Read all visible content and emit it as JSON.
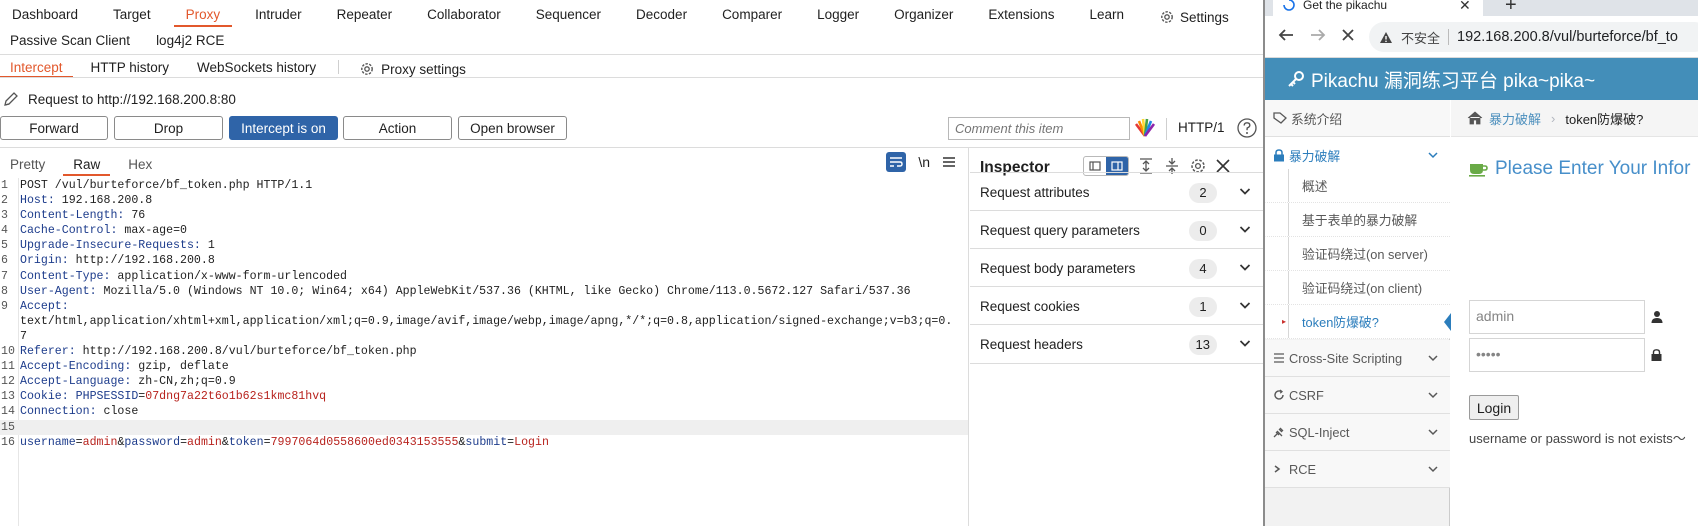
{
  "burp": {
    "main_tabs": [
      "Dashboard",
      "Target",
      "Proxy",
      "Intruder",
      "Repeater",
      "Collaborator",
      "Sequencer",
      "Decoder",
      "Comparer",
      "Logger",
      "Organizer",
      "Extensions",
      "Learn"
    ],
    "settings_label": "Settings",
    "ext_tabs": [
      "Passive Scan Client",
      "log4j2 RCE"
    ],
    "proxy_tabs": [
      "Intercept",
      "HTTP history",
      "WebSockets history"
    ],
    "proxy_settings_label": "Proxy settings",
    "request_to": "Request to http://192.168.200.8:80",
    "buttons": {
      "forward": "Forward",
      "drop": "Drop",
      "intercept": "Intercept is on",
      "action": "Action",
      "open_browser": "Open browser"
    },
    "comment_placeholder": "Comment this item",
    "http_version": "HTTP/1",
    "editor_tabs": [
      "Pretty",
      "Raw",
      "Hex"
    ],
    "newline_toggle": "\\n",
    "request_lines": [
      {
        "n": "1",
        "parts": [
          {
            "t": "POST /vul/burteforce/bf_token.php HTTP/1.1",
            "c": "hv"
          }
        ]
      },
      {
        "n": "2",
        "parts": [
          {
            "t": "Host:",
            "c": "hk"
          },
          {
            "t": " 192.168.200.8",
            "c": "hv"
          }
        ]
      },
      {
        "n": "3",
        "parts": [
          {
            "t": "Content-Length:",
            "c": "hk"
          },
          {
            "t": " 76",
            "c": "hv"
          }
        ]
      },
      {
        "n": "4",
        "parts": [
          {
            "t": "Cache-Control:",
            "c": "hk"
          },
          {
            "t": " max-age=0",
            "c": "hv"
          }
        ]
      },
      {
        "n": "5",
        "parts": [
          {
            "t": "Upgrade-Insecure-Requests:",
            "c": "hk"
          },
          {
            "t": " 1",
            "c": "hv"
          }
        ]
      },
      {
        "n": "6",
        "parts": [
          {
            "t": "Origin:",
            "c": "hk"
          },
          {
            "t": " http://192.168.200.8",
            "c": "hv"
          }
        ]
      },
      {
        "n": "7",
        "parts": [
          {
            "t": "Content-Type:",
            "c": "hk"
          },
          {
            "t": " application/x-www-form-urlencoded",
            "c": "hv"
          }
        ]
      },
      {
        "n": "8",
        "parts": [
          {
            "t": "User-Agent:",
            "c": "hk"
          },
          {
            "t": " Mozilla/5.0 (Windows NT 10.0; Win64; x64) AppleWebKit/537.36 (KHTML, like Gecko) Chrome/113.0.5672.127 Safari/537.36",
            "c": "hv"
          }
        ]
      },
      {
        "n": "9",
        "parts": [
          {
            "t": "Accept:",
            "c": "hk"
          },
          {
            "t": "\ntext/html,application/xhtml+xml,application/xml;q=0.9,image/avif,image/webp,image/apng,*/*;q=0.8,application/signed-exchange;v=b3;q=0.7",
            "c": "hv"
          }
        ]
      },
      {
        "n": "10",
        "parts": [
          {
            "t": "Referer:",
            "c": "hk"
          },
          {
            "t": " http://192.168.200.8/vul/burteforce/bf_token.php",
            "c": "hv"
          }
        ]
      },
      {
        "n": "11",
        "parts": [
          {
            "t": "Accept-Encoding:",
            "c": "hk"
          },
          {
            "t": " gzip, deflate",
            "c": "hv"
          }
        ]
      },
      {
        "n": "12",
        "parts": [
          {
            "t": "Accept-Language:",
            "c": "hk"
          },
          {
            "t": " zh-CN,zh;q=0.9",
            "c": "hv"
          }
        ]
      },
      {
        "n": "13",
        "parts": [
          {
            "t": "Cookie:",
            "c": "hk"
          },
          {
            "t": " PHPSESSID",
            "c": "hk"
          },
          {
            "t": "=",
            "c": "hv"
          },
          {
            "t": "07dng7a22t6o1b62s1kmc81hvq",
            "c": "ck"
          }
        ]
      },
      {
        "n": "14",
        "parts": [
          {
            "t": "Connection:",
            "c": "hk"
          },
          {
            "t": " close",
            "c": "hv"
          }
        ]
      },
      {
        "n": "15",
        "parts": [
          {
            "t": "",
            "c": "hv"
          }
        ],
        "hl": true
      },
      {
        "n": "16",
        "parts": [
          {
            "t": "username",
            "c": "pk"
          },
          {
            "t": "=",
            "c": "hv"
          },
          {
            "t": "admin",
            "c": "pv"
          },
          {
            "t": "&",
            "c": "hv"
          },
          {
            "t": "password",
            "c": "pk"
          },
          {
            "t": "=",
            "c": "hv"
          },
          {
            "t": "admin",
            "c": "pv"
          },
          {
            "t": "&",
            "c": "hv"
          },
          {
            "t": "token",
            "c": "pk"
          },
          {
            "t": "=",
            "c": "hv"
          },
          {
            "t": "7997064d0558600ed0343153555",
            "c": "pv"
          },
          {
            "t": "&",
            "c": "hv"
          },
          {
            "t": "submit",
            "c": "pk"
          },
          {
            "t": "=",
            "c": "hv"
          },
          {
            "t": "Login",
            "c": "pv"
          }
        ]
      }
    ],
    "inspector": {
      "title": "Inspector",
      "sections": [
        {
          "label": "Request attributes",
          "count": "2"
        },
        {
          "label": "Request query parameters",
          "count": "0"
        },
        {
          "label": "Request body parameters",
          "count": "4"
        },
        {
          "label": "Request cookies",
          "count": "1"
        },
        {
          "label": "Request headers",
          "count": "13"
        }
      ]
    }
  },
  "browser": {
    "tab_title": "Get the pikachu",
    "insecure_label": "不安全",
    "url": "192.168.200.8/vul/burteforce/bf_to",
    "site_title": "Pikachu 漏洞练习平台 pika~pika~",
    "sidebar": {
      "top_items": [
        "系统介绍",
        "暴力破解"
      ],
      "sub_items": [
        "概述",
        "基于表单的暴力破解",
        "验证码绕过(on server)",
        "验证码绕过(on client)",
        "token防爆破?"
      ],
      "bottom_items": [
        "Cross-Site Scripting",
        "CSRF",
        "SQL-Inject",
        "RCE"
      ]
    },
    "breadcrumb": {
      "parent": "暴力破解",
      "current": "token防爆破?"
    },
    "login": {
      "title": "Please Enter Your Infor",
      "username": "admin",
      "password": "•••••",
      "button": "Login",
      "message": "username or password is not exists～"
    }
  }
}
